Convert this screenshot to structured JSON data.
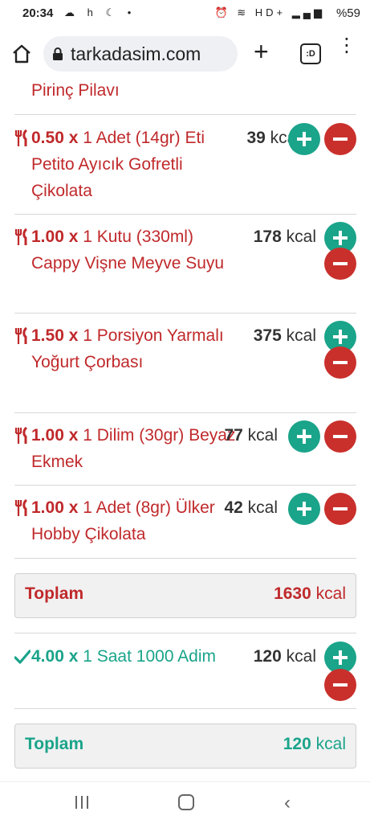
{
  "status_bar": {
    "time": "20:34",
    "left_icons": [
      "cloud-icon",
      "h",
      "sleep-icon",
      "dot"
    ],
    "h_text": "h",
    "right_text": "HD+",
    "battery": "%59"
  },
  "browser": {
    "url": "tarkadasim.com",
    "tab_count": ":D"
  },
  "partial_item": {
    "name": "Pirinç Pilavı"
  },
  "food_items": [
    {
      "mult": "0.50 x",
      "desc": "1 Adet (14gr) Eti Petito Ayıcık Gofretli Çikolata",
      "kcal_num": "39",
      "kcal_unit": "kcal"
    },
    {
      "mult": "1.00 x",
      "desc": "1 Kutu (330ml) Cappy Vişne Meyve Suyu",
      "kcal_num": "178",
      "kcal_unit": "kcal"
    },
    {
      "mult": "1.50 x",
      "desc": "1 Porsiyon Yarmalı Yoğurt Çorbası",
      "kcal_num": "375",
      "kcal_unit": "kcal"
    },
    {
      "mult": "1.00 x",
      "desc": "1 Dilim (30gr) Beyaz Ekmek",
      "kcal_num": "77",
      "kcal_unit": "kcal"
    },
    {
      "mult": "1.00 x",
      "desc": "1 Adet (8gr) Ülker Hobby Çikolata",
      "kcal_num": "42",
      "kcal_unit": "kcal"
    }
  ],
  "food_total": {
    "label": "Toplam",
    "value": "1630",
    "unit": "kcal"
  },
  "activity_items": [
    {
      "mult": "4.00 x",
      "desc": "1 Saat 1000 Adim",
      "kcal_num": "120",
      "kcal_unit": "kcal"
    }
  ],
  "activity_total": {
    "label": "Toplam",
    "value": "120",
    "unit": "kcal"
  },
  "colors": {
    "red": "#c0292b",
    "green": "#1aa48a",
    "remove_button": "#c9302c"
  },
  "nav_bar": [
    "recents-icon",
    "home-icon",
    "back-icon"
  ]
}
